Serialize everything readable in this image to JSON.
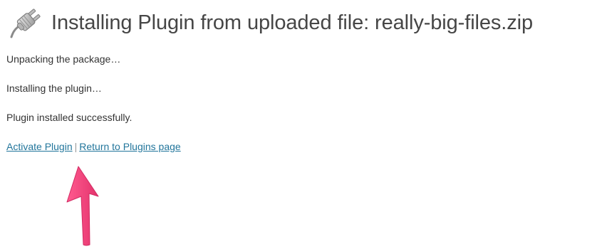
{
  "header": {
    "title": "Installing Plugin from uploaded file: really-big-files.zip",
    "icon": "plugin-plug-icon"
  },
  "log": {
    "messages": [
      "Unpacking the package…",
      "Installing the plugin…",
      "Plugin installed successfully."
    ]
  },
  "actions": {
    "activate_label": "Activate Plugin",
    "separator": "|",
    "return_label": "Return to Plugins page"
  },
  "annotation": {
    "icon": "arrow-up-icon",
    "color": "#f0407a"
  },
  "colors": {
    "link": "#21759b",
    "text": "#333333",
    "title": "#464646"
  }
}
